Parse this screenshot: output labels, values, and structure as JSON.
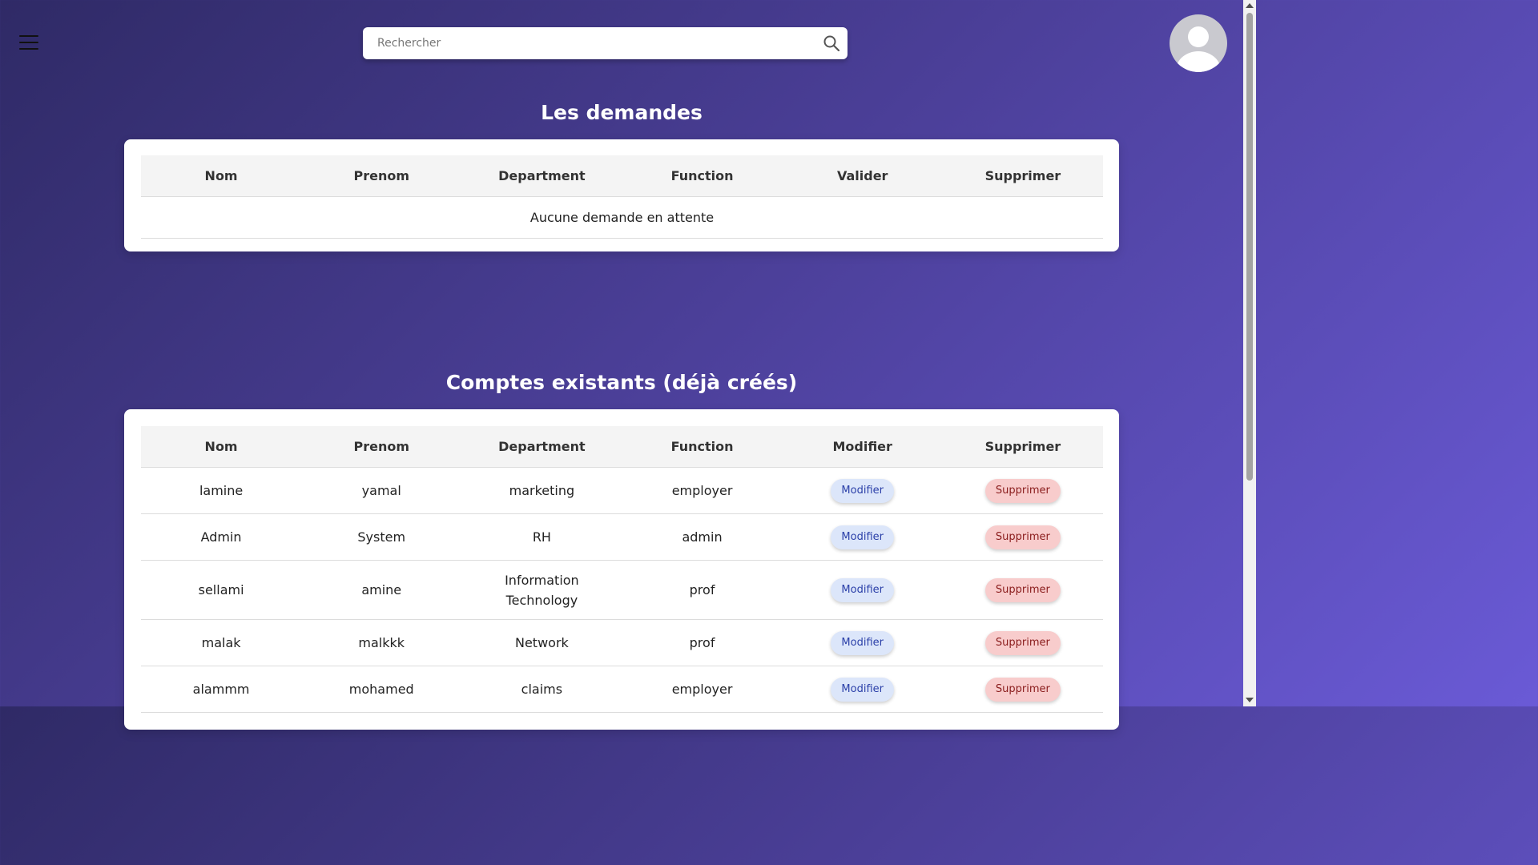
{
  "search": {
    "placeholder": "Rechercher"
  },
  "requests": {
    "title": "Les demandes",
    "headers": [
      "Nom",
      "Prenom",
      "Department",
      "Function",
      "Valider",
      "Supprimer"
    ],
    "empty_message": "Aucune demande en attente"
  },
  "accounts": {
    "title": "Comptes existants (déjà créés)",
    "headers": [
      "Nom",
      "Prenom",
      "Department",
      "Function",
      "Modifier",
      "Supprimer"
    ],
    "modify_label": "Modifier",
    "delete_label": "Supprimer",
    "rows": [
      {
        "nom": "lamine",
        "prenom": "yamal",
        "department": "marketing",
        "function": "employer"
      },
      {
        "nom": "Admin",
        "prenom": "System",
        "department": "RH",
        "function": "admin"
      },
      {
        "nom": "sellami",
        "prenom": "amine",
        "department": "Information Technology",
        "function": "prof"
      },
      {
        "nom": "malak",
        "prenom": "malkkk",
        "department": "Network",
        "function": "prof"
      },
      {
        "nom": "alammm",
        "prenom": "mohamed",
        "department": "claims",
        "function": "employer"
      }
    ]
  }
}
